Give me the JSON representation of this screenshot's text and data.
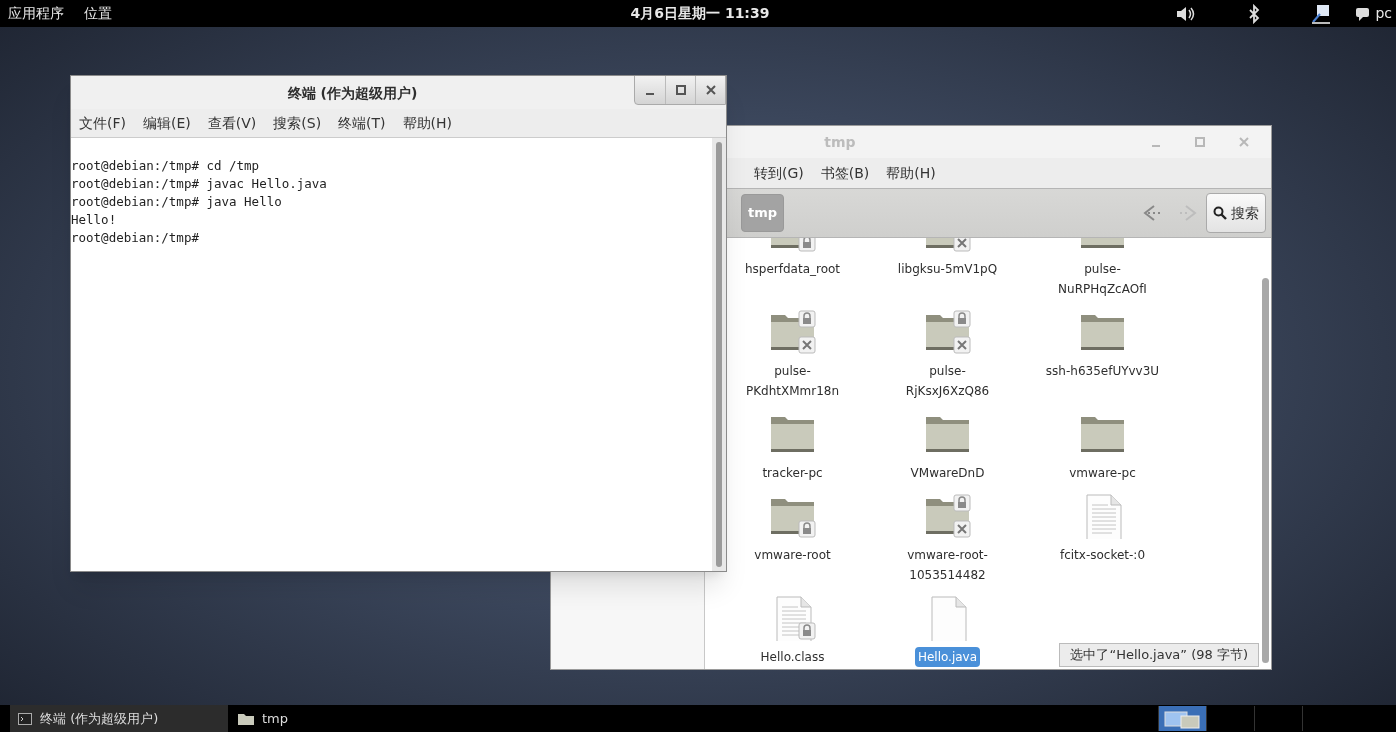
{
  "top_bar": {
    "menus": [
      "应用程序",
      "位置"
    ],
    "clock": "4月6日星期一 11:39",
    "user": "pc"
  },
  "file_manager": {
    "title": "tmp",
    "menus": [
      "转到(G)",
      "书签(B)",
      "帮助(H)"
    ],
    "path_buttons": [
      {
        "label": "tmp",
        "selected": true
      }
    ],
    "search_label": "搜索",
    "files": [
      {
        "name": "hsperfdata_root",
        "kind": "folder-locked",
        "selected": false
      },
      {
        "name": "libgksu-5mV1pQ",
        "kind": "folder-noaccess",
        "selected": false
      },
      {
        "name": "pulse-NuRPHqZcAOfI",
        "kind": "folder",
        "selected": false
      },
      {
        "name": "pulse-PKdhtXMmr18n",
        "kind": "folder-noaccess",
        "selected": false
      },
      {
        "name": "pulse-RjKsxJ6XzQ86",
        "kind": "folder-noaccess",
        "selected": false
      },
      {
        "name": "ssh-h635efUYvv3U",
        "kind": "folder",
        "selected": false
      },
      {
        "name": "tracker-pc",
        "kind": "folder",
        "selected": false
      },
      {
        "name": "VMwareDnD",
        "kind": "folder",
        "selected": false
      },
      {
        "name": "vmware-pc",
        "kind": "folder",
        "selected": false
      },
      {
        "name": "vmware-root",
        "kind": "folder-locked",
        "selected": false
      },
      {
        "name": "vmware-root-1053514482",
        "kind": "folder-noaccess",
        "selected": false
      },
      {
        "name": "fcitx-socket-:0",
        "kind": "text",
        "selected": false
      },
      {
        "name": "Hello.class",
        "kind": "text-locked",
        "selected": false
      },
      {
        "name": "Hello.java",
        "kind": "blank",
        "selected": true
      }
    ],
    "status": "选中了“Hello.java” (98 字节)"
  },
  "terminal": {
    "title": "终端 (作为超级用户)",
    "menus": [
      "文件(F)",
      "编辑(E)",
      "查看(V)",
      "搜索(S)",
      "终端(T)",
      "帮助(H)"
    ],
    "lines": [
      "root@debian:/tmp# cd /tmp",
      "root@debian:/tmp# javac Hello.java",
      "root@debian:/tmp# java Hello",
      "Hello!",
      "root@debian:/tmp#"
    ]
  },
  "taskbar": {
    "tasks": [
      {
        "label": "终端 (作为超级用户)",
        "kind": "terminal",
        "selected": true
      },
      {
        "label": "tmp",
        "kind": "folder",
        "selected": false
      }
    ],
    "workspaces": [
      {
        "selected": true
      },
      {
        "selected": false
      },
      {
        "selected": false
      },
      {
        "selected": false
      }
    ]
  }
}
